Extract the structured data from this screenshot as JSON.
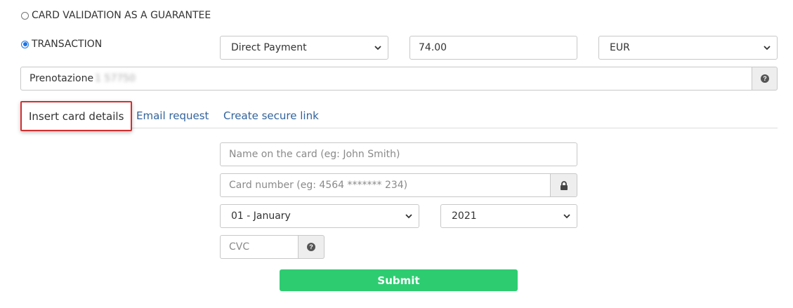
{
  "payment_type": {
    "option_validation": "CARD VALIDATION AS A GUARANTEE",
    "option_transaction": "TRANSACTION",
    "selected": "transaction"
  },
  "transaction": {
    "method": "Direct Payment",
    "amount": "74.00",
    "currency": "EUR",
    "description": "Prenotazione",
    "description_hidden": "1 57750"
  },
  "tabs": [
    {
      "label": "Insert card details",
      "active": true
    },
    {
      "label": "Email request",
      "active": false
    },
    {
      "label": "Create secure link",
      "active": false
    }
  ],
  "card_form": {
    "name_placeholder": "Name on the card (eg: John Smith)",
    "number_placeholder": "Card number (eg: 4564 ******* 234)",
    "month": "01 - January",
    "year": "2021",
    "cvc_placeholder": "CVC",
    "submit_label": "Submit"
  },
  "icons": {
    "help": "question-circle-icon",
    "lock": "lock-icon",
    "dropdown": "chevron-down-icon"
  },
  "colors": {
    "submit": "#2ecc71",
    "link": "#31639c",
    "active_tab_border": "#d32f2f"
  }
}
